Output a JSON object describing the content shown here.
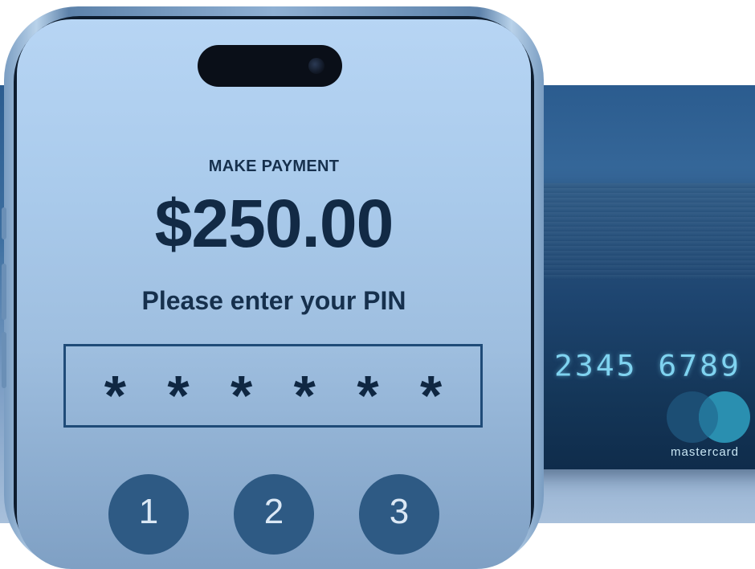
{
  "payment": {
    "heading": "MAKE PAYMENT",
    "amount": "$250.00",
    "pin_prompt": "Please enter your PIN",
    "pin_mask": [
      "*",
      "*",
      "*",
      "*",
      "*",
      "*"
    ]
  },
  "keypad": {
    "keys": [
      "1",
      "2",
      "3"
    ]
  },
  "card": {
    "number_fragment": "2345 6789",
    "brand": "mastercard"
  },
  "colors": {
    "screen_bg": "#aacbec",
    "text_dark": "#122a45",
    "key_bg": "#2e5a84",
    "card_bg": "#1e4570",
    "card_number": "#7fd3f0"
  }
}
